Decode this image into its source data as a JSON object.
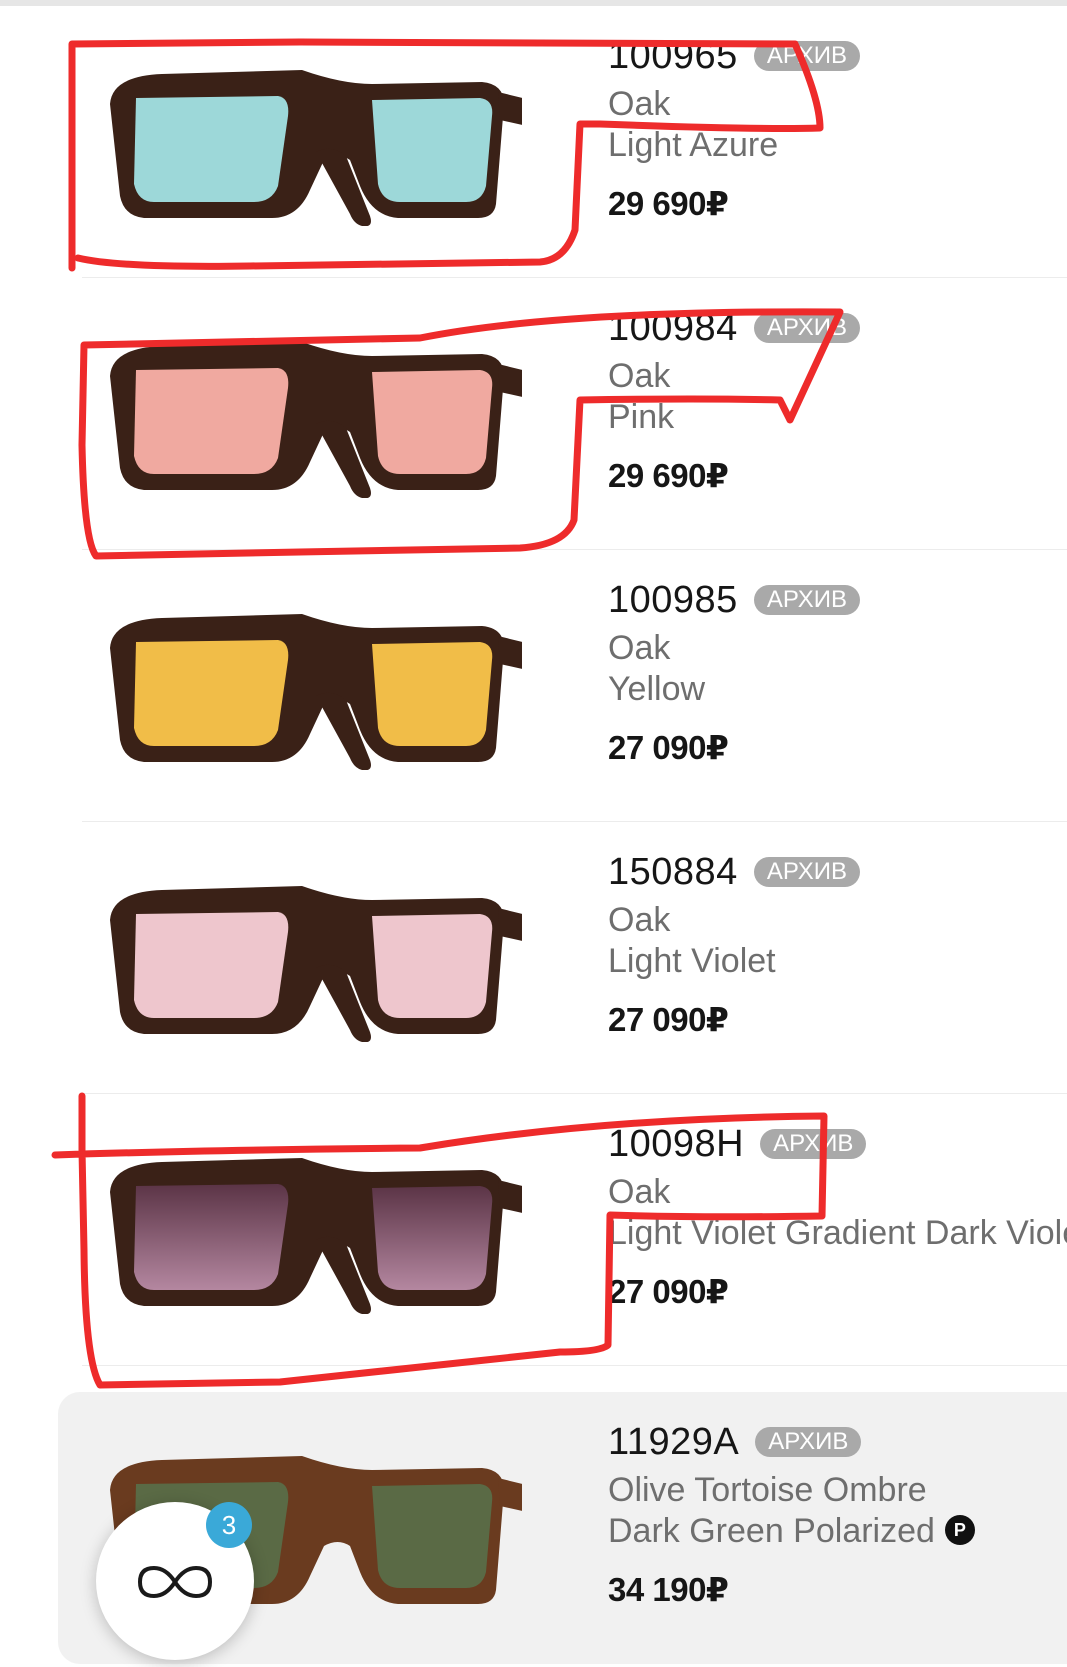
{
  "products": [
    {
      "sku": "100965",
      "badge": "АРХИВ",
      "name": "Oak",
      "color": "Light Azure",
      "price": "29 690₽",
      "lens_color": "#9dd8d9"
    },
    {
      "sku": "100984",
      "badge": "АРХИВ",
      "name": "Oak",
      "color": "Pink",
      "price": "29 690₽",
      "lens_color": "#f0a9a0"
    },
    {
      "sku": "100985",
      "badge": "АРХИВ",
      "name": "Oak",
      "color": "Yellow",
      "price": "27 090₽",
      "lens_color": "#f1bd48"
    },
    {
      "sku": "150884",
      "badge": "АРХИВ",
      "name": "Oak",
      "color": "Light Violet",
      "price": "27 090₽",
      "lens_color": "#eec6cd"
    },
    {
      "sku": "10098H",
      "badge": "АРХИВ",
      "name": "Oak",
      "color": "Light Violet Gradient Dark Violet",
      "price": "27 090₽",
      "lens_color": "#8f5b73"
    },
    {
      "sku": "11929A",
      "badge": "АРХИВ",
      "name": "Olive Tortoise Ombre",
      "color": "Dark Green Polarized",
      "price": "34 190₽",
      "lens_color": "#5a6a45",
      "polarized_icon": "P"
    }
  ],
  "compare_fab": {
    "icon": "glasses-outline-icon",
    "count": "3"
  },
  "frame_color": "#3a2117",
  "annotation_color": "#ee2b2b"
}
